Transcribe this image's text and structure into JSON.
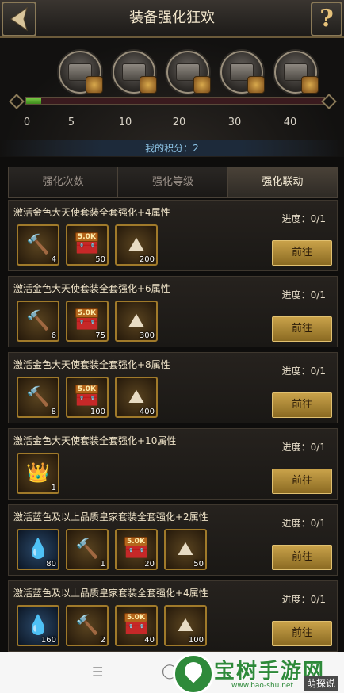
{
  "header": {
    "title": "装备强化狂欢",
    "help_glyph": "?"
  },
  "milestones": {
    "ticks": [
      "0",
      "5",
      "10",
      "20",
      "30",
      "40"
    ],
    "progress_fraction": 0.05,
    "chest_icons": [
      "chest-icon",
      "chest-icon",
      "chest-icon",
      "chest-icon",
      "chest-icon"
    ]
  },
  "score": {
    "label": "我的积分：2"
  },
  "tabs": [
    {
      "label": "强化次数",
      "active": false
    },
    {
      "label": "强化等级",
      "active": false
    },
    {
      "label": "强化联动",
      "active": true
    }
  ],
  "tasks": [
    {
      "title": "激活金色大天使套装全套强化+4属性",
      "progress": "进度：0/1",
      "button": "前往",
      "items": [
        {
          "icon": "mace-icon",
          "count": "4"
        },
        {
          "icon": "chest-icon",
          "tag": "5.0K",
          "count": "50"
        },
        {
          "icon": "ore-icon",
          "count": "200"
        }
      ]
    },
    {
      "title": "激活金色大天使套装全套强化+6属性",
      "progress": "进度：0/1",
      "button": "前往",
      "items": [
        {
          "icon": "mace-icon",
          "count": "6"
        },
        {
          "icon": "chest-icon",
          "tag": "5.0K",
          "count": "75"
        },
        {
          "icon": "ore-icon",
          "count": "300"
        }
      ]
    },
    {
      "title": "激活金色大天使套装全套强化+8属性",
      "progress": "进度：0/1",
      "button": "前往",
      "items": [
        {
          "icon": "mace-icon",
          "count": "8"
        },
        {
          "icon": "chest-icon",
          "tag": "5.0K",
          "count": "100"
        },
        {
          "icon": "ore-icon",
          "count": "400"
        }
      ]
    },
    {
      "title": "激活金色大天使套装全套强化+10属性",
      "progress": "进度：0/1",
      "button": "前往",
      "items": [
        {
          "icon": "crown-icon",
          "count": "1"
        }
      ]
    },
    {
      "title": "激活蓝色及以上品质皇家套装全套强化+2属性",
      "progress": "进度：0/1",
      "button": "前往",
      "items": [
        {
          "icon": "blue-gem-icon",
          "count": "80"
        },
        {
          "icon": "mace-icon",
          "count": "1"
        },
        {
          "icon": "chest-icon",
          "tag": "5.0K",
          "count": "20"
        },
        {
          "icon": "ore-icon",
          "count": "50"
        }
      ]
    },
    {
      "title": "激活蓝色及以上品质皇家套装全套强化+4属性",
      "progress": "进度：0/1",
      "button": "前往",
      "items": [
        {
          "icon": "blue-gem-icon",
          "count": "160"
        },
        {
          "icon": "mace-icon",
          "count": "2"
        },
        {
          "icon": "chest-icon",
          "tag": "5.0K",
          "count": "40"
        },
        {
          "icon": "ore-icon",
          "count": "100"
        }
      ]
    }
  ],
  "watermark": {
    "text": "宝树手游网",
    "url": "www.bao-shu.net",
    "corner": "萌探说"
  }
}
